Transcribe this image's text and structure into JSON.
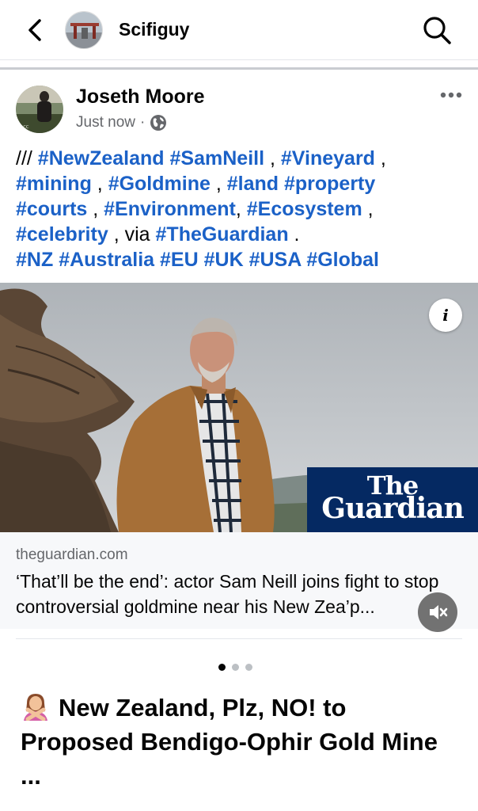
{
  "header": {
    "group_name": "Scifiguy"
  },
  "post": {
    "author": "Joseth Moore",
    "time": "Just now",
    "meta_separator": "·",
    "text": {
      "prefix": "/// ",
      "tags_line1": [
        "#NewZealand",
        "#SamNeill",
        "#Vineyard"
      ],
      "tags_line2": [
        "#mining",
        "#Goldmine",
        "#land",
        "#property"
      ],
      "tags_line3": [
        "#courts",
        "#Environment",
        "#Ecosystem"
      ],
      "tag_celebrity": "#celebrity",
      "via": "via",
      "tag_guardian": "#TheGuardian",
      "tags_line5": [
        "#NZ",
        "#Australia",
        "#EU",
        "#UK",
        "#USA",
        "#Global"
      ]
    },
    "photo": {
      "info_glyph": "i",
      "brand_line1": "The",
      "brand_line2": "Guardian"
    },
    "link": {
      "domain": "theguardian.com",
      "title": "‘That’ll be the end’: actor Sam Neill joins fight to stop controversial goldmine near his New Zea’p..."
    },
    "carousel": {
      "count": 3,
      "active": 1
    }
  },
  "next_post": {
    "title": "New Zealand, Plz, NO! to Proposed Bendigo-Ophir Gold Mine ..."
  },
  "colors": {
    "hashtag": "#1b61c7",
    "guardian_blue": "#052962",
    "meta_gray": "#65676b"
  },
  "icons": [
    "back-arrow-icon",
    "search-icon",
    "more-options-icon",
    "globe-icon",
    "info-icon",
    "mute-icon",
    "woman-gesturing-no-icon"
  ]
}
